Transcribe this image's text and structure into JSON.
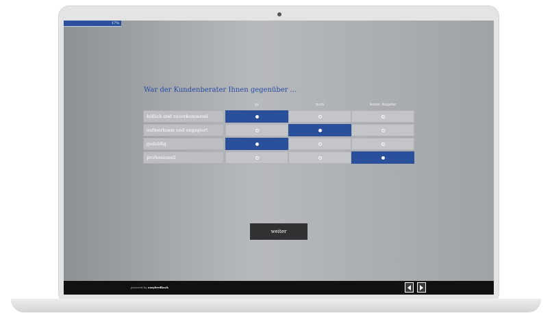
{
  "progress": {
    "percent": 17,
    "label": "17%"
  },
  "survey": {
    "question": "War der Kundenberater Ihnen gegenüber ...",
    "columns": [
      "ja",
      "nein",
      "keine Angabe"
    ],
    "rows": [
      {
        "label": "höflich und zuvorkommend",
        "selected": 0
      },
      {
        "label": "aufmerksam und engagiert",
        "selected": 1
      },
      {
        "label": "geduldig",
        "selected": 0
      },
      {
        "label": "professionell",
        "selected": 2
      }
    ]
  },
  "buttons": {
    "next_label": "weiter"
  },
  "footer": {
    "powered_prefix": "powered by",
    "powered_brand": "easyfeedback",
    "prev_icon": "arrow-left-icon",
    "next_icon": "arrow-right-icon"
  },
  "colors": {
    "accent": "#2a4f9b",
    "footer": "#111111",
    "button": "#2f3132"
  }
}
